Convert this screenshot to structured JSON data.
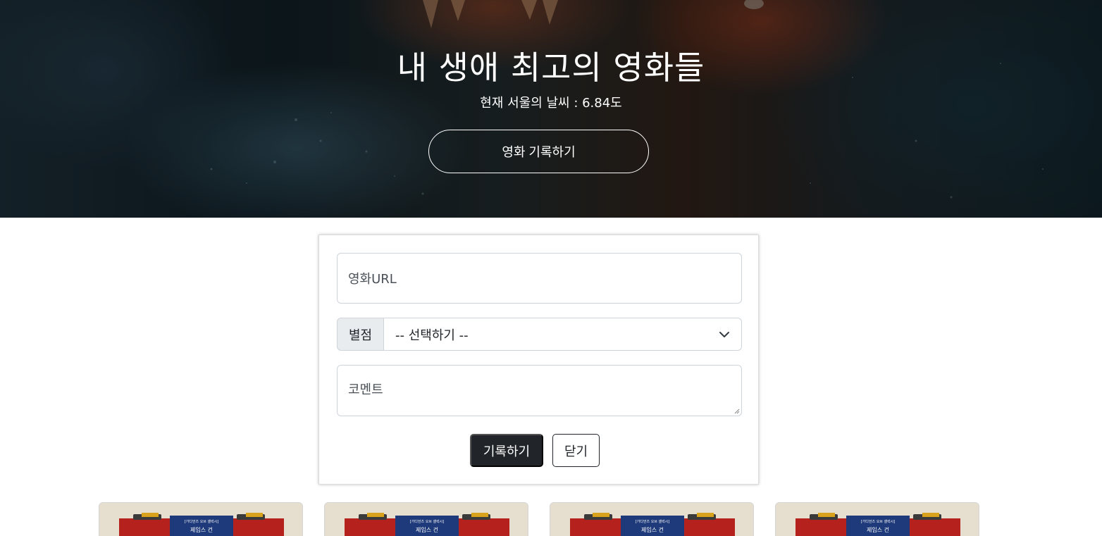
{
  "hero": {
    "title": "내 생애 최고의 영화들",
    "weather": "현재 서울의 날씨 : 6.84도",
    "record_button": "영화 기록하기"
  },
  "form": {
    "url_placeholder": "영화URL",
    "rating_label": "별점",
    "rating_selected": "-- 선택하기 --",
    "comment_placeholder": "코멘트",
    "save_button": "기록하기",
    "close_button": "닫기"
  },
  "movies": [
    {
      "poster_subtitle": "[가디언즈 오브 갤럭시]",
      "poster_title": "제임스 건"
    },
    {
      "poster_subtitle": "[가디언즈 오브 갤럭시]",
      "poster_title": "제임스 건"
    },
    {
      "poster_subtitle": "[가디언즈 오브 갤럭시]",
      "poster_title": "제임스 건"
    },
    {
      "poster_subtitle": "[가디언즈 오브 갤럭시]",
      "poster_title": "제임스 건"
    }
  ],
  "colors": {
    "primary_button": "#212529",
    "border": "#ced4da",
    "input_addon": "#e9ecef",
    "poster_red": "#b5211c",
    "poster_blue": "#1e3a7a"
  },
  "icons": {
    "select_arrow": "chevron-down-icon"
  }
}
